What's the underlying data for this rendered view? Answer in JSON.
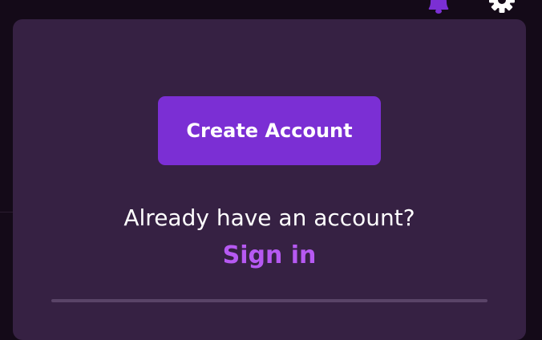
{
  "header": {
    "icons": [
      "bell-icon",
      "gear-icon"
    ]
  },
  "panel": {
    "create_account_label": "Create Account",
    "already_have_account_text": "Already have an account?",
    "sign_in_label": "Sign in"
  },
  "colors": {
    "page_background": "#140a18",
    "panel_background": "#362143",
    "button_background": "#7b2fd4",
    "link_color": "#b659f2",
    "divider_color": "#5a4468",
    "bell_color": "#7b2fd4"
  }
}
